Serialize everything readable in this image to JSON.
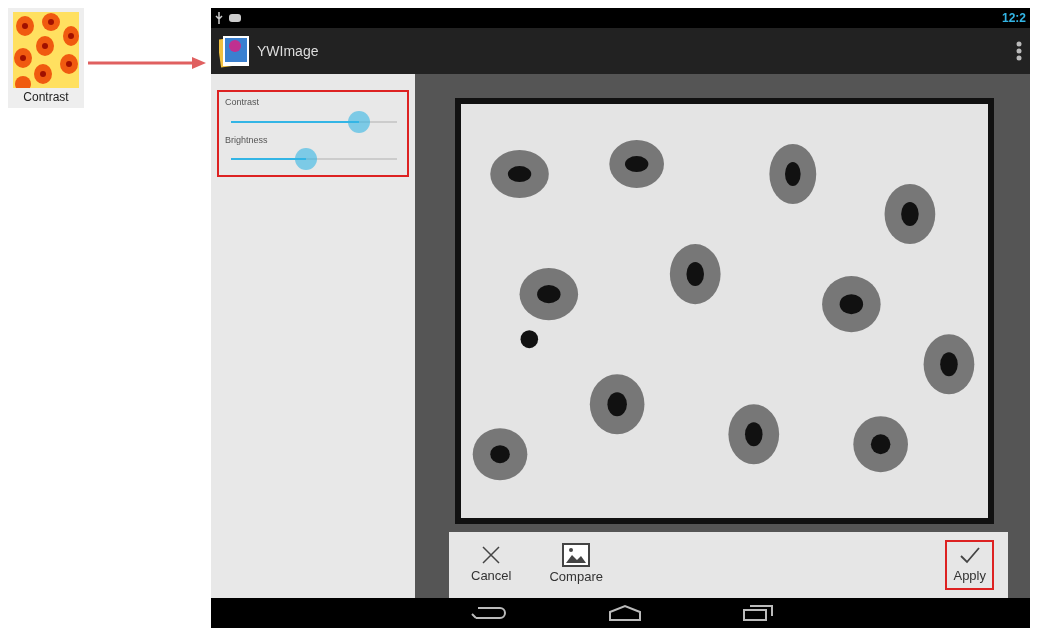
{
  "filter_thumbnail": {
    "label": "Contrast"
  },
  "status_bar": {
    "time": "12:2"
  },
  "action_bar": {
    "title": "YWImage"
  },
  "adjustments": {
    "highlighted": true,
    "sliders": [
      {
        "label": "Contrast",
        "level": 0.77
      },
      {
        "label": "Brightness",
        "level": 0.45
      }
    ]
  },
  "bottom_actions": [
    {
      "kind": "cancel",
      "label": "Cancel",
      "highlighted": false
    },
    {
      "kind": "compare",
      "label": "Compare",
      "highlighted": false
    },
    {
      "kind": "apply",
      "label": "Apply",
      "highlighted": true
    }
  ]
}
